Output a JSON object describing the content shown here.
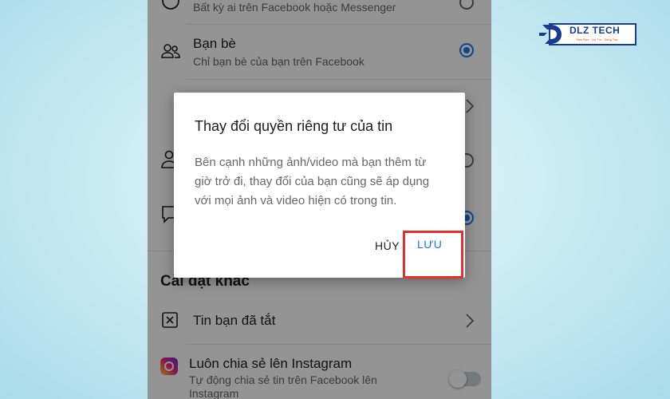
{
  "privacy_options": [
    {
      "title": "",
      "subtitle": "Bất kỳ ai trên Facebook hoặc Messenger"
    },
    {
      "title": "Bạn bè",
      "subtitle": "Chỉ bạn bè của bạn trên Facebook",
      "selected": true
    }
  ],
  "section_title": "Cài đặt khác",
  "other_settings": [
    {
      "label": "Tin bạn đã tắt"
    },
    {
      "label": "Luôn chia sẻ lên Instagram",
      "subtitle": "Tự động chia sẻ tin trên Facebook lên Instagram",
      "enabled": false
    }
  ],
  "dialog": {
    "title": "Thay đổi quyền riêng tư của tin",
    "body": "Bên cạnh những ảnh/video mà bạn thêm từ giờ trở đi, thay đổi của bạn cũng sẽ áp dụng với mọi ảnh và video hiện có trong tin.",
    "cancel_label": "HỦY",
    "save_label": "LƯU"
  },
  "watermark": {
    "brand": "DLZ TECH",
    "tagline": "Tâm Đức - Uy Tín - Sáng Tạo"
  },
  "colors": {
    "accent": "#1877f2",
    "highlight": "#e03131",
    "brand": "#1a3c8f"
  }
}
